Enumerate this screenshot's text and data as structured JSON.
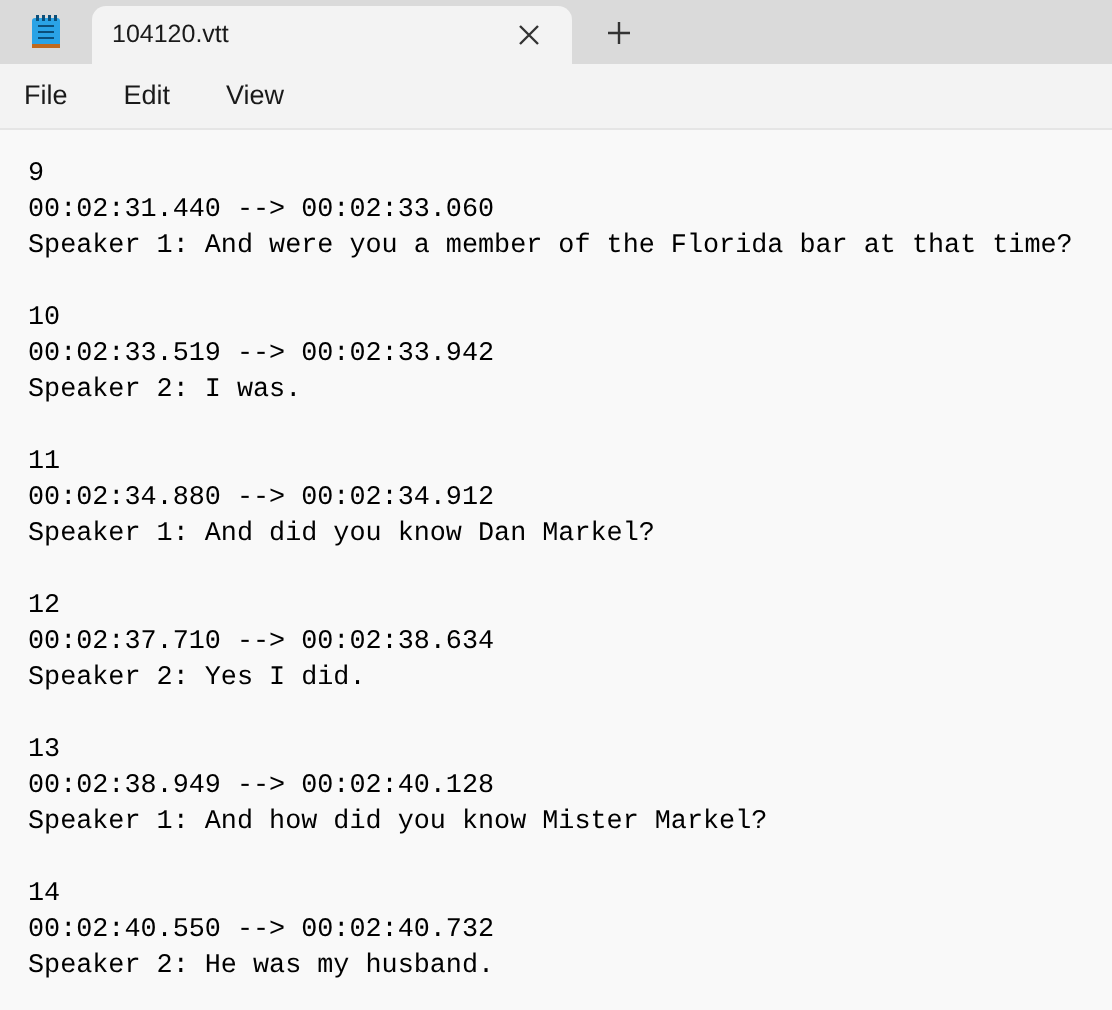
{
  "tab": {
    "title": "104120.vtt",
    "selected": true
  },
  "menu": [
    "File",
    "Edit",
    "View"
  ],
  "cues": [
    {
      "index": "9",
      "timing": "00:02:31.440 --> 00:02:33.060",
      "text": "Speaker 1: And were you a member of the Florida bar at that time?"
    },
    {
      "index": "10",
      "timing": "00:02:33.519 --> 00:02:33.942",
      "text": "Speaker 2: I was."
    },
    {
      "index": "11",
      "timing": "00:02:34.880 --> 00:02:34.912",
      "text": "Speaker 1: And did you know Dan Markel?"
    },
    {
      "index": "12",
      "timing": "00:02:37.710 --> 00:02:38.634",
      "text": "Speaker 2: Yes I did."
    },
    {
      "index": "13",
      "timing": "00:02:38.949 --> 00:02:40.128",
      "text": "Speaker 1: And how did you know Mister Markel?"
    },
    {
      "index": "14",
      "timing": "00:02:40.550 --> 00:02:40.732",
      "text": "Speaker 2: He was my husband."
    }
  ]
}
